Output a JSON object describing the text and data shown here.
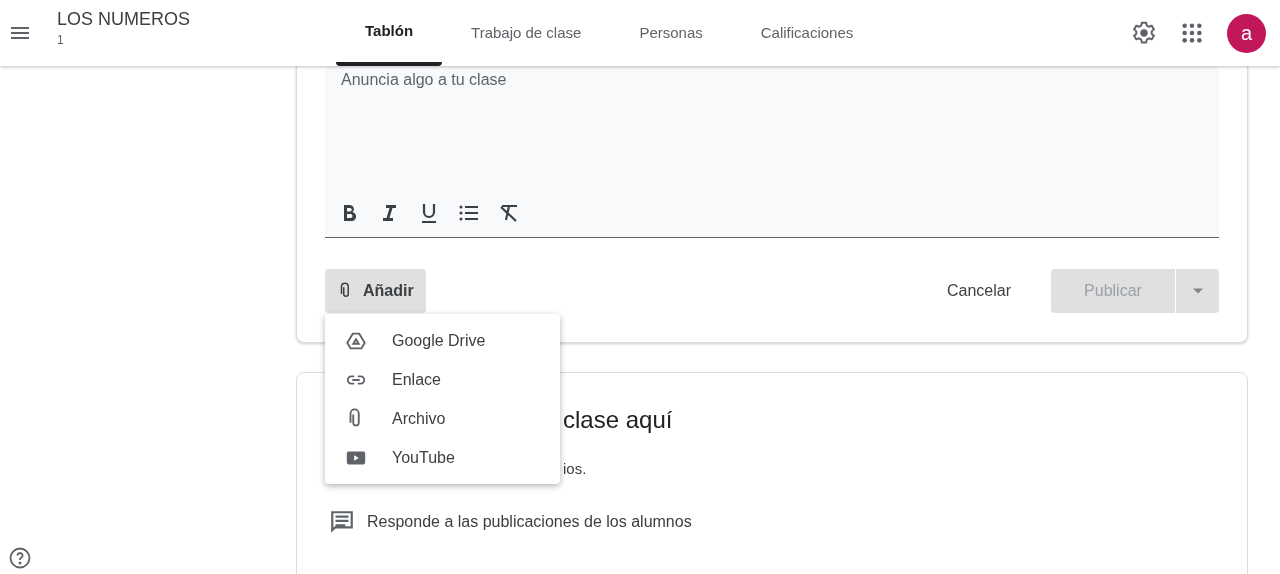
{
  "header": {
    "class_name": "LOS NUMEROS",
    "section": "1",
    "avatar": "a"
  },
  "tabs": [
    {
      "label": "Tablón",
      "selected": true
    },
    {
      "label": "Trabajo de clase",
      "selected": false
    },
    {
      "label": "Personas",
      "selected": false
    },
    {
      "label": "Calificaciones",
      "selected": false
    }
  ],
  "composer": {
    "placeholder": "Anuncia algo a tu clase",
    "toolbar": [
      {
        "kind": "bold"
      },
      {
        "kind": "italic"
      },
      {
        "kind": "underline"
      },
      {
        "kind": "list"
      },
      {
        "kind": "clear"
      }
    ],
    "add_button": "Añadir",
    "cancel_button": "Cancelar",
    "publish_button": {
      "label": "Publicar",
      "disabled": true
    }
  },
  "add_menu": [
    {
      "kind": "drive",
      "label": "Google Drive"
    },
    {
      "kind": "link",
      "label": "Enlace"
    },
    {
      "kind": "file",
      "label": "Archivo"
    },
    {
      "kind": "youtube",
      "label": "YouTube"
    }
  ],
  "info_card": {
    "title": "clase aquí",
    "text": "ios.",
    "tip": "Responde a las publicaciones de los alumnos"
  }
}
